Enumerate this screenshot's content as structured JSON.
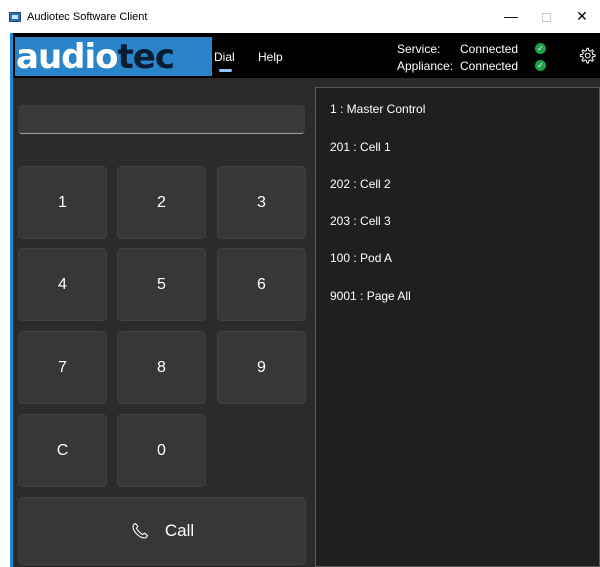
{
  "window": {
    "title": "Audiotec Software Client",
    "minimize_glyph": "—",
    "close_glyph": "✕"
  },
  "header": {
    "logo": {
      "part1": "audio",
      "part2": "tec",
      "part3": ""
    },
    "nav": [
      {
        "label": "Dial"
      },
      {
        "label": "Help"
      }
    ],
    "status": [
      {
        "label": "Service:",
        "value": "Connected",
        "icon": "check-circle-icon"
      },
      {
        "label": "Appliance:",
        "value": "Connected",
        "icon": "check-circle-icon"
      }
    ],
    "settings_icon": "gear-icon"
  },
  "dialer": {
    "input_value": "",
    "keys": [
      "1",
      "2",
      "3",
      "4",
      "5",
      "6",
      "7",
      "8",
      "9",
      "C",
      "0"
    ],
    "call_label": "Call",
    "call_icon": "phone-icon"
  },
  "contacts": [
    {
      "label": "1 : Master Control"
    },
    {
      "label": "201 : Cell 1"
    },
    {
      "label": "202 : Cell 2"
    },
    {
      "label": "203 : Cell 3"
    },
    {
      "label": "100 : Pod A"
    },
    {
      "label": "9001 : Page All"
    }
  ],
  "colors": {
    "brand_blue": "#2a84c9",
    "status_green": "#1fa04a",
    "panel_bg": "#2b2b2b",
    "key_bg": "#373737"
  }
}
